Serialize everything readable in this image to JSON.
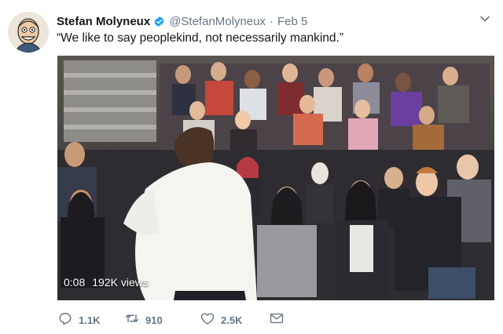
{
  "tweet": {
    "author_name": "Stefan Molyneux",
    "handle": "@StefanMolyneux",
    "separator": "·",
    "date": "Feb 5",
    "text": "“We like to say peoplekind, not necessarily mankind.”"
  },
  "video": {
    "time": "0:08",
    "views": "192K views"
  },
  "actions": {
    "reply_count": "1.1K",
    "retweet_count": "910",
    "like_count": "2.5K"
  },
  "icons": {
    "verified": "verified-badge-icon",
    "menu": "chevron-down-icon",
    "reply": "reply-icon",
    "retweet": "retweet-icon",
    "like": "heart-icon",
    "message": "envelope-icon"
  },
  "colors": {
    "verified": "#1da1f2",
    "muted": "#657786",
    "text": "#14171a"
  }
}
